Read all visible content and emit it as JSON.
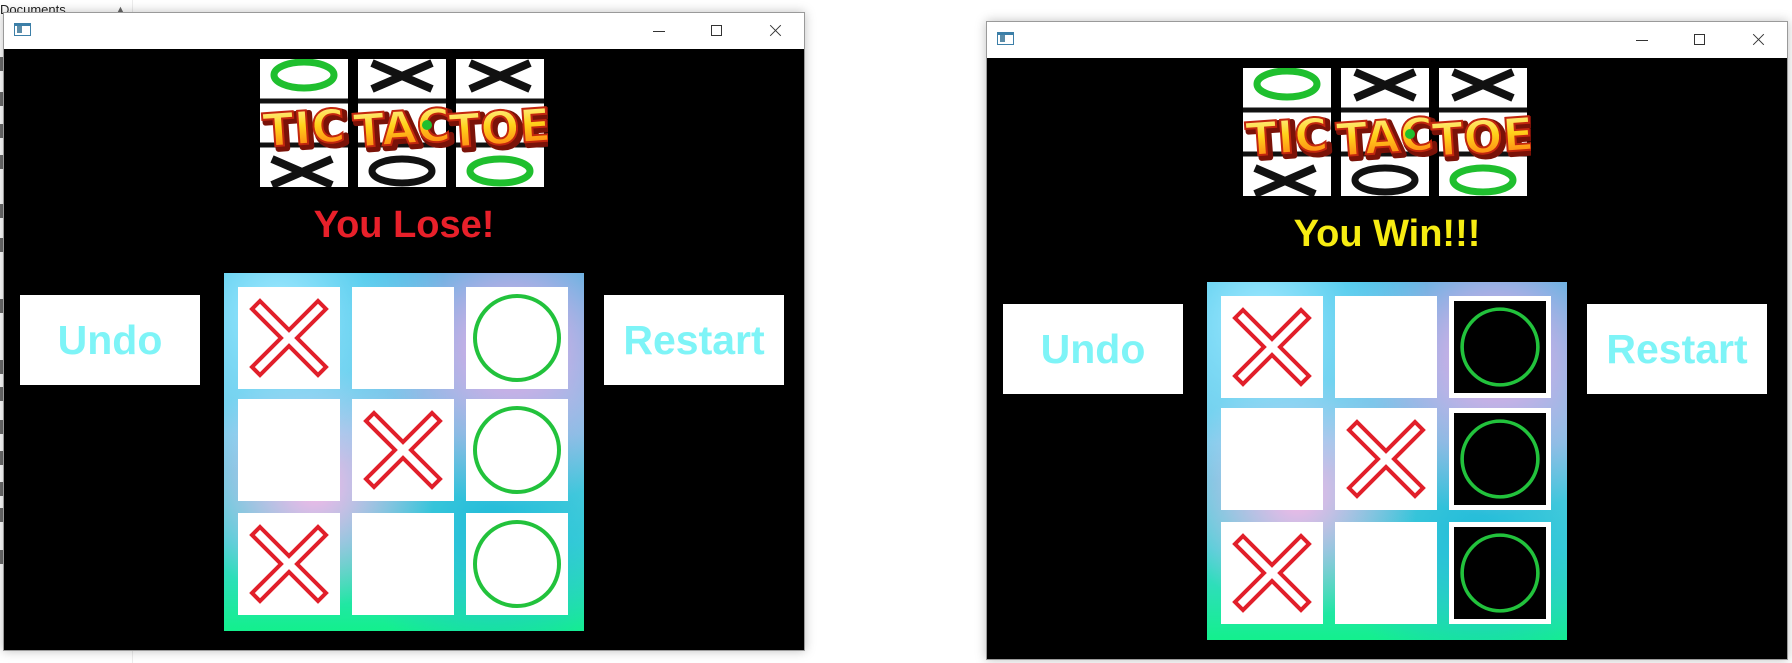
{
  "background_explorer": {
    "peek_text": "Documents"
  },
  "windows": [
    {
      "id": "left",
      "title": "",
      "status": "You Lose!",
      "status_color": "#e8202a",
      "undo_label": "Undo",
      "restart_label": "Restart",
      "board": [
        [
          "X",
          "",
          "O"
        ],
        [
          "",
          "X",
          "O"
        ],
        [
          "X",
          "",
          "O"
        ]
      ],
      "winning_line": [],
      "winning_cells_style": "none"
    },
    {
      "id": "right",
      "title": "",
      "status": "You Win!!!",
      "status_color": "#f7ec12",
      "undo_label": "Undo",
      "restart_label": "Restart",
      "board": [
        [
          "X",
          "",
          "O"
        ],
        [
          "",
          "X",
          "O"
        ],
        [
          "X",
          "",
          "O"
        ]
      ],
      "winning_line": [
        [
          0,
          2
        ],
        [
          1,
          2
        ],
        [
          2,
          2
        ]
      ],
      "winning_cells_style": "inverted-black"
    }
  ],
  "logo": {
    "text_parts": [
      "TIC",
      "TAC",
      "TOE"
    ]
  },
  "colors": {
    "x_mark": "#e11f2a",
    "o_mark": "#22c23c",
    "button_text": "#7ef4f7",
    "window_bg": "#000000",
    "cell_bg": "#ffffff"
  },
  "icons": {
    "app": "app-window-icon",
    "minimize": "minimize-icon",
    "maximize": "maximize-icon",
    "close": "close-icon"
  }
}
